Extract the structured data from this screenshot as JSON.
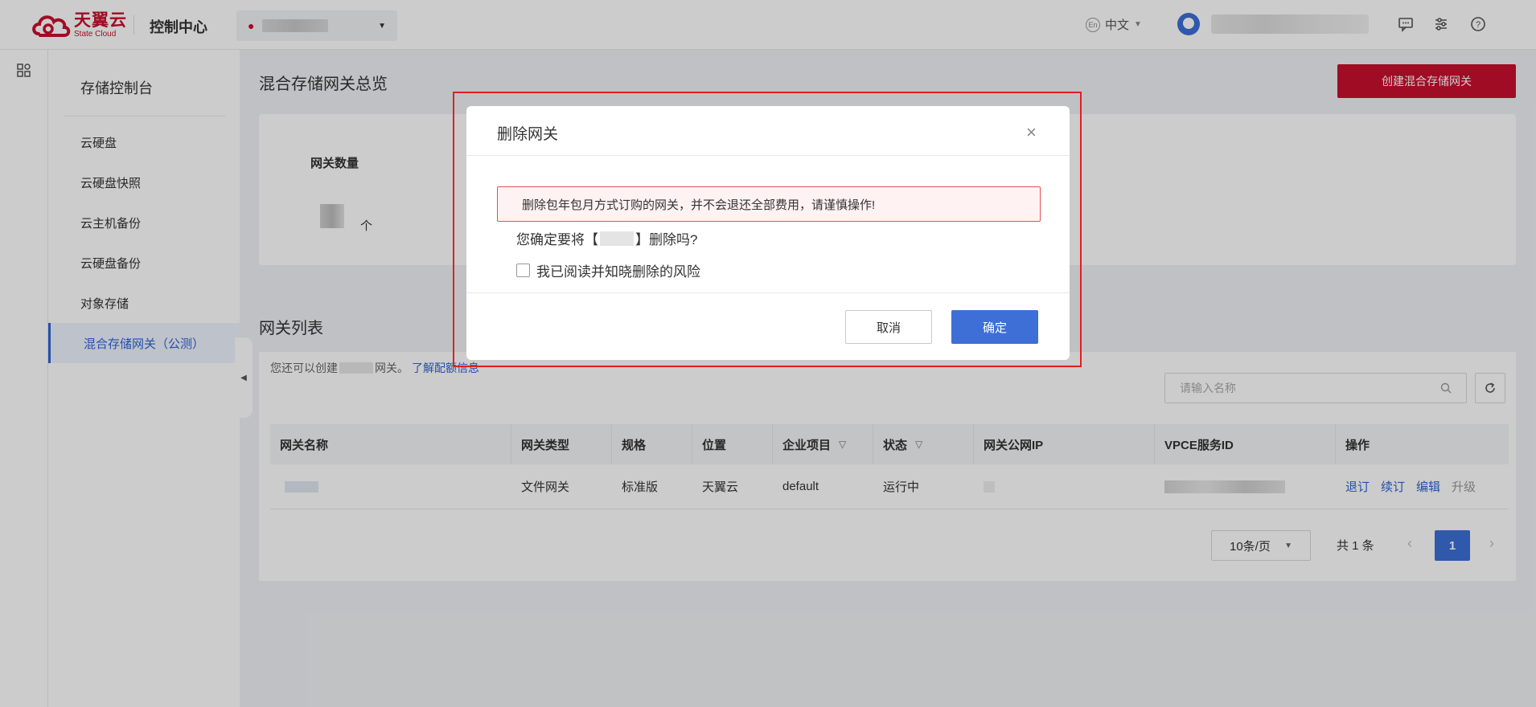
{
  "header": {
    "logo_cn": "天翼云",
    "logo_en": "State Cloud",
    "console_label": "控制中心",
    "language": "中文",
    "lang_badge": "En"
  },
  "sidebar": {
    "title": "存储控制台",
    "items": [
      {
        "label": "云硬盘"
      },
      {
        "label": "云硬盘快照"
      },
      {
        "label": "云主机备份"
      },
      {
        "label": "云硬盘备份"
      },
      {
        "label": "对象存储"
      },
      {
        "label": "混合存储网关（公测）",
        "active": true
      }
    ]
  },
  "main": {
    "title": "混合存储网关总览",
    "create_button": "创建混合存储网关",
    "overview": {
      "gateway_count_label": "网关数量",
      "unit": "个"
    },
    "list": {
      "title": "网关列表",
      "quota_prefix": "您还可以创建",
      "quota_suffix": "网关。",
      "quota_link": "了解配额信息",
      "search_placeholder": "请输入名称",
      "columns": [
        "网关名称",
        "网关类型",
        "规格",
        "位置",
        "企业项目",
        "状态",
        "网关公网IP",
        "VPCE服务ID",
        "操作"
      ],
      "rows": [
        {
          "type": "文件网关",
          "spec": "标准版",
          "location": "天翼云",
          "project": "default",
          "status": "运行中",
          "actions": [
            "退订",
            "续订",
            "编辑",
            "升级"
          ]
        }
      ],
      "pagination": {
        "page_size": "10条/页",
        "total": "共 1 条",
        "current_page": "1"
      }
    }
  },
  "modal": {
    "title": "删除网关",
    "warning": "删除包年包月方式订购的网关，并不会退还全部费用，请谨慎操作!",
    "confirm_prefix": "您确定要将【",
    "confirm_suffix": "】删除吗?",
    "ack_label": "我已阅读并知晓删除的风险",
    "cancel_label": "取消",
    "ok_label": "确定"
  },
  "colors": {
    "brand_red": "#c8102e",
    "primary_blue": "#3d6fd6",
    "annotation_red": "#e02020"
  }
}
